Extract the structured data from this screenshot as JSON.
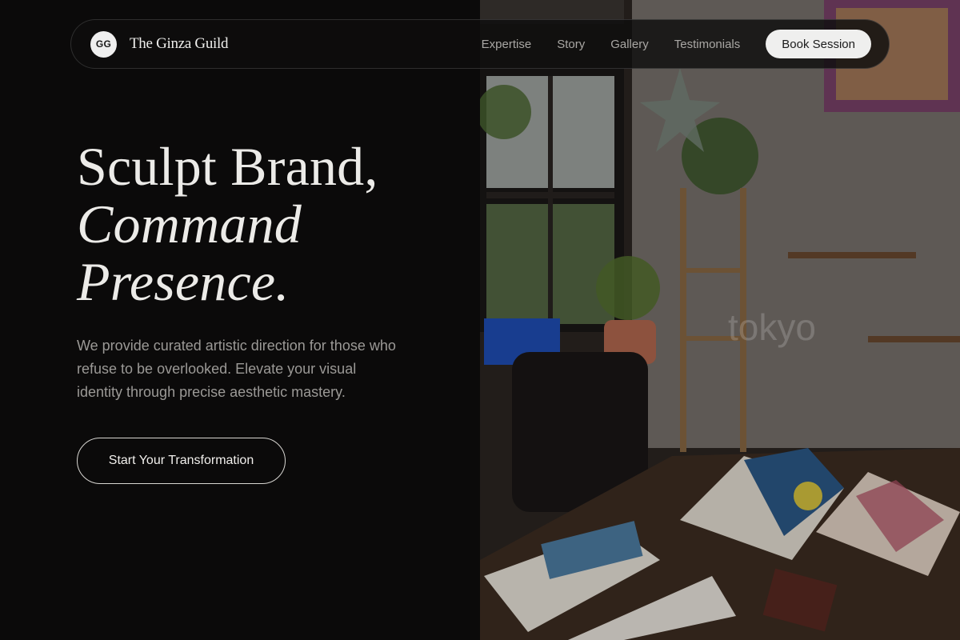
{
  "brand": {
    "logo_text": "GG",
    "name": "The Ginza Guild"
  },
  "nav": {
    "links": [
      "Expertise",
      "Story",
      "Gallery",
      "Testimonials"
    ],
    "cta": "Book Session"
  },
  "hero": {
    "headline_line1": "Sculpt Brand,",
    "headline_line2": "Command",
    "headline_line3": "Presence.",
    "lede": "We provide curated artistic direction for those who refuse to be overlooked. Elevate your visual identity through precise aesthetic mastery.",
    "cta": "Start Your Transformation"
  },
  "photo": {
    "watermark": "tokyo"
  },
  "colors": {
    "background": "#0b0a0a",
    "text_primary": "#ecebe8",
    "text_muted": "#9b9996",
    "pill": "#efefee"
  }
}
